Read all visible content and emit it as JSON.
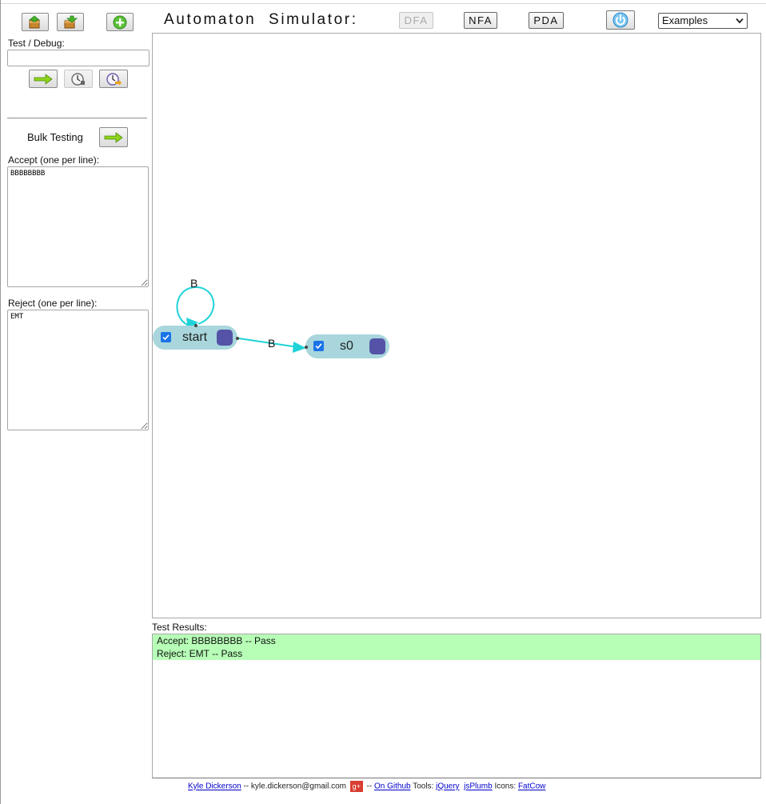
{
  "header": {
    "title": "Automaton  Simulator:",
    "modes": [
      {
        "label": "DFA",
        "active": true
      },
      {
        "label": "NFA",
        "active": false
      },
      {
        "label": "PDA",
        "active": false
      }
    ],
    "examples_select": {
      "value": "Examples"
    }
  },
  "toolbar": {
    "icons": [
      "load-box-icon",
      "save-box-icon",
      "add-state-icon"
    ]
  },
  "debug": {
    "label": "Test / Debug:",
    "input_value": "",
    "buttons": [
      "run-arrow-icon",
      "step-clock-icon",
      "step-forward-clock-icon"
    ]
  },
  "bulk": {
    "label": "Bulk Testing",
    "accept_label": "Accept (one per line):",
    "accept_text": "BBBBBBBB",
    "reject_label": "Reject (one per line):",
    "reject_text": "EMT"
  },
  "canvas": {
    "states": [
      {
        "id": "start",
        "label": "start",
        "accepting": true
      },
      {
        "id": "s0",
        "label": "s0",
        "accepting": true
      }
    ],
    "transitions": [
      {
        "from": "start",
        "to": "start",
        "symbol": "B"
      },
      {
        "from": "start",
        "to": "s0",
        "symbol": "B"
      }
    ],
    "edge_color": "#1fd3d8",
    "state_color": "#a8d6dc",
    "handle_color": "#5553a8"
  },
  "results": {
    "label": "Test Results:",
    "rows": [
      "Accept: BBBBBBBB -- Pass",
      "Reject: EMT -- Pass"
    ],
    "pass_color": "#b7ffb7"
  },
  "footer": {
    "author": "Kyle Dickerson",
    "email_text": " -- kyle.dickerson@gmail.com ",
    "gplus": "g+",
    "sep": " -- ",
    "github": "On Github",
    "tools_label": "  Tools: ",
    "jquery": "jQuery",
    "jsplumb": "jsPlumb",
    "icons_label": "  Icons: ",
    "fatcow": "FatCow"
  }
}
